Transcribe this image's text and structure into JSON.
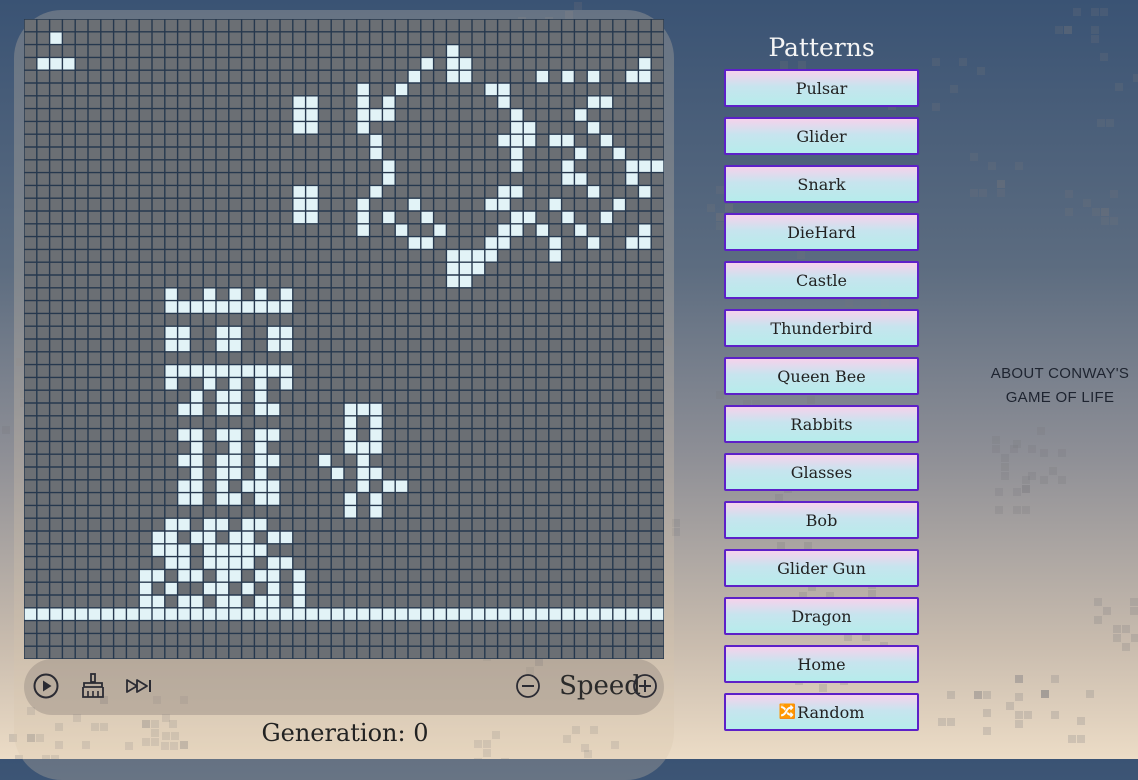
{
  "game": {
    "generation_label": "Generation:",
    "generation": "0",
    "speed_label": "Speed",
    "cols": 50,
    "rows": 50
  },
  "controls": {
    "play_icon": "play-circle-icon",
    "clear_icon": "broom-icon",
    "step_icon": "fast-forward-icon",
    "speed_down_icon": "minus-circle-icon",
    "speed_up_icon": "plus-circle-icon"
  },
  "patterns": {
    "title": "Patterns",
    "items": [
      "Pulsar",
      "Glider",
      "Snark",
      "DieHard",
      "Castle",
      "Thunderbird",
      "Queen Bee",
      "Rabbits",
      "Glasses",
      "Bob",
      "Glider Gun",
      "Dragon",
      "Home",
      "Random"
    ],
    "random_icon": "shuffle-icon"
  },
  "about": {
    "line1": "ABOUT CONWAY'S",
    "line2": "GAME OF LIFE"
  },
  "colors": {
    "grid_line": "#26384e",
    "dead_cell": "#6b6f74",
    "live_cell": "#e2f3f7",
    "button_border": "#5d20c8"
  },
  "live_cells": [
    [
      2,
      1
    ],
    [
      1,
      3
    ],
    [
      2,
      3
    ],
    [
      3,
      3
    ],
    [
      33,
      2
    ],
    [
      33,
      3
    ],
    [
      34,
      3
    ],
    [
      33,
      4
    ],
    [
      34,
      4
    ],
    [
      36,
      5
    ],
    [
      37,
      5
    ],
    [
      37,
      6
    ],
    [
      38,
      7
    ],
    [
      38,
      8
    ],
    [
      39,
      8
    ],
    [
      37,
      9
    ],
    [
      38,
      9
    ],
    [
      39,
      9
    ],
    [
      38,
      10
    ],
    [
      31,
      3
    ],
    [
      30,
      4
    ],
    [
      29,
      5
    ],
    [
      28,
      6
    ],
    [
      28,
      7
    ],
    [
      27,
      7
    ],
    [
      40,
      4
    ],
    [
      42,
      4
    ],
    [
      44,
      4
    ],
    [
      48,
      3
    ],
    [
      47,
      4
    ],
    [
      48,
      4
    ],
    [
      50,
      4
    ],
    [
      50,
      5
    ],
    [
      50,
      6
    ],
    [
      50,
      7
    ],
    [
      50,
      8
    ],
    [
      50,
      9
    ],
    [
      43,
      7
    ],
    [
      44,
      8
    ],
    [
      45,
      9
    ],
    [
      46,
      10
    ],
    [
      44,
      6
    ],
    [
      45,
      6
    ],
    [
      41,
      9
    ],
    [
      42,
      9
    ],
    [
      38,
      11
    ],
    [
      43,
      10
    ],
    [
      42,
      11
    ],
    [
      42,
      12
    ],
    [
      43,
      12
    ],
    [
      44,
      13
    ],
    [
      47,
      11
    ],
    [
      48,
      11
    ],
    [
      49,
      11
    ],
    [
      50,
      11
    ],
    [
      47,
      12
    ],
    [
      48,
      13
    ],
    [
      21,
      6
    ],
    [
      22,
      6
    ],
    [
      21,
      7
    ],
    [
      22,
      7
    ],
    [
      21,
      8
    ],
    [
      22,
      8
    ],
    [
      21,
      13
    ],
    [
      22,
      13
    ],
    [
      21,
      14
    ],
    [
      22,
      14
    ],
    [
      21,
      15
    ],
    [
      22,
      15
    ],
    [
      26,
      5
    ],
    [
      26,
      6
    ],
    [
      26,
      7
    ],
    [
      26,
      8
    ],
    [
      27,
      9
    ],
    [
      27,
      10
    ],
    [
      28,
      11
    ],
    [
      28,
      12
    ],
    [
      27,
      13
    ],
    [
      26,
      14
    ],
    [
      26,
      15
    ],
    [
      26,
      16
    ],
    [
      28,
      15
    ],
    [
      29,
      16
    ],
    [
      30,
      17
    ],
    [
      31,
      17
    ],
    [
      30,
      14
    ],
    [
      31,
      15
    ],
    [
      32,
      16
    ],
    [
      50,
      12
    ],
    [
      50,
      13
    ],
    [
      50,
      14
    ],
    [
      50,
      15
    ],
    [
      50,
      16
    ],
    [
      48,
      17
    ],
    [
      47,
      17
    ],
    [
      48,
      16
    ],
    [
      50,
      17
    ],
    [
      50,
      18
    ],
    [
      37,
      13
    ],
    [
      38,
      13
    ],
    [
      36,
      14
    ],
    [
      37,
      14
    ],
    [
      38,
      15
    ],
    [
      39,
      15
    ],
    [
      37,
      16
    ],
    [
      38,
      16
    ],
    [
      36,
      17
    ],
    [
      37,
      17
    ],
    [
      35,
      18
    ],
    [
      36,
      18
    ],
    [
      34,
      18
    ],
    [
      33,
      18
    ],
    [
      34,
      19
    ],
    [
      33,
      19
    ],
    [
      33,
      20
    ],
    [
      34,
      20
    ],
    [
      35,
      19
    ],
    [
      41,
      14
    ],
    [
      42,
      15
    ],
    [
      43,
      16
    ],
    [
      40,
      16
    ],
    [
      44,
      17
    ],
    [
      45,
      15
    ],
    [
      46,
      14
    ],
    [
      41,
      17
    ],
    [
      41,
      18
    ],
    [
      11,
      21
    ],
    [
      14,
      21
    ],
    [
      16,
      21
    ],
    [
      18,
      21
    ],
    [
      20,
      21
    ],
    [
      11,
      22
    ],
    [
      12,
      22
    ],
    [
      13,
      22
    ],
    [
      14,
      22
    ],
    [
      15,
      22
    ],
    [
      16,
      22
    ],
    [
      17,
      22
    ],
    [
      18,
      22
    ],
    [
      19,
      22
    ],
    [
      20,
      22
    ],
    [
      11,
      24
    ],
    [
      12,
      24
    ],
    [
      15,
      24
    ],
    [
      16,
      24
    ],
    [
      19,
      24
    ],
    [
      20,
      24
    ],
    [
      11,
      25
    ],
    [
      12,
      25
    ],
    [
      15,
      25
    ],
    [
      16,
      25
    ],
    [
      19,
      25
    ],
    [
      20,
      25
    ],
    [
      11,
      27
    ],
    [
      12,
      27
    ],
    [
      13,
      27
    ],
    [
      14,
      27
    ],
    [
      15,
      27
    ],
    [
      16,
      27
    ],
    [
      17,
      27
    ],
    [
      18,
      27
    ],
    [
      19,
      27
    ],
    [
      20,
      27
    ],
    [
      11,
      28
    ],
    [
      14,
      28
    ],
    [
      16,
      28
    ],
    [
      18,
      28
    ],
    [
      20,
      28
    ],
    [
      13,
      29
    ],
    [
      15,
      29
    ],
    [
      16,
      29
    ],
    [
      18,
      29
    ],
    [
      12,
      30
    ],
    [
      13,
      30
    ],
    [
      15,
      30
    ],
    [
      16,
      30
    ],
    [
      18,
      30
    ],
    [
      19,
      30
    ],
    [
      12,
      32
    ],
    [
      13,
      32
    ],
    [
      15,
      32
    ],
    [
      16,
      32
    ],
    [
      18,
      32
    ],
    [
      19,
      32
    ],
    [
      13,
      33
    ],
    [
      16,
      33
    ],
    [
      18,
      33
    ],
    [
      12,
      34
    ],
    [
      13,
      34
    ],
    [
      15,
      34
    ],
    [
      16,
      34
    ],
    [
      18,
      34
    ],
    [
      19,
      34
    ],
    [
      13,
      35
    ],
    [
      15,
      35
    ],
    [
      16,
      35
    ],
    [
      18,
      35
    ],
    [
      12,
      36
    ],
    [
      13,
      36
    ],
    [
      15,
      36
    ],
    [
      17,
      36
    ],
    [
      18,
      36
    ],
    [
      19,
      36
    ],
    [
      12,
      37
    ],
    [
      13,
      37
    ],
    [
      15,
      37
    ],
    [
      16,
      37
    ],
    [
      18,
      37
    ],
    [
      19,
      37
    ],
    [
      11,
      39
    ],
    [
      12,
      39
    ],
    [
      14,
      39
    ],
    [
      15,
      39
    ],
    [
      17,
      39
    ],
    [
      18,
      39
    ],
    [
      10,
      40
    ],
    [
      11,
      40
    ],
    [
      13,
      40
    ],
    [
      14,
      40
    ],
    [
      16,
      40
    ],
    [
      17,
      40
    ],
    [
      19,
      40
    ],
    [
      20,
      40
    ],
    [
      10,
      41
    ],
    [
      11,
      41
    ],
    [
      12,
      41
    ],
    [
      14,
      41
    ],
    [
      15,
      41
    ],
    [
      16,
      41
    ],
    [
      17,
      41
    ],
    [
      18,
      41
    ],
    [
      11,
      42
    ],
    [
      12,
      42
    ],
    [
      14,
      42
    ],
    [
      15,
      42
    ],
    [
      16,
      42
    ],
    [
      17,
      42
    ],
    [
      19,
      42
    ],
    [
      20,
      42
    ],
    [
      9,
      43
    ],
    [
      10,
      43
    ],
    [
      12,
      43
    ],
    [
      13,
      43
    ],
    [
      15,
      43
    ],
    [
      16,
      43
    ],
    [
      18,
      43
    ],
    [
      19,
      43
    ],
    [
      21,
      43
    ],
    [
      9,
      44
    ],
    [
      11,
      44
    ],
    [
      14,
      44
    ],
    [
      15,
      44
    ],
    [
      17,
      44
    ],
    [
      19,
      44
    ],
    [
      21,
      44
    ],
    [
      9,
      45
    ],
    [
      10,
      45
    ],
    [
      12,
      45
    ],
    [
      13,
      45
    ],
    [
      15,
      45
    ],
    [
      16,
      45
    ],
    [
      18,
      45
    ],
    [
      19,
      45
    ],
    [
      21,
      45
    ],
    [
      25,
      30
    ],
    [
      26,
      30
    ],
    [
      27,
      30
    ],
    [
      25,
      31
    ],
    [
      27,
      31
    ],
    [
      25,
      32
    ],
    [
      27,
      32
    ],
    [
      25,
      33
    ],
    [
      26,
      33
    ],
    [
      27,
      33
    ],
    [
      23,
      34
    ],
    [
      26,
      34
    ],
    [
      24,
      35
    ],
    [
      26,
      35
    ],
    [
      27,
      35
    ],
    [
      28,
      36
    ],
    [
      29,
      36
    ],
    [
      26,
      36
    ],
    [
      25,
      37
    ],
    [
      27,
      37
    ],
    [
      25,
      38
    ],
    [
      27,
      38
    ],
    [
      0,
      46
    ],
    [
      1,
      46
    ],
    [
      2,
      46
    ],
    [
      3,
      46
    ],
    [
      4,
      46
    ],
    [
      5,
      46
    ],
    [
      6,
      46
    ],
    [
      7,
      46
    ],
    [
      8,
      46
    ],
    [
      9,
      46
    ],
    [
      10,
      46
    ],
    [
      11,
      46
    ],
    [
      12,
      46
    ],
    [
      13,
      46
    ],
    [
      14,
      46
    ],
    [
      15,
      46
    ],
    [
      16,
      46
    ],
    [
      17,
      46
    ],
    [
      18,
      46
    ],
    [
      19,
      46
    ],
    [
      20,
      46
    ],
    [
      21,
      46
    ],
    [
      22,
      46
    ],
    [
      23,
      46
    ],
    [
      24,
      46
    ],
    [
      25,
      46
    ],
    [
      26,
      46
    ],
    [
      27,
      46
    ],
    [
      28,
      46
    ],
    [
      29,
      46
    ],
    [
      30,
      46
    ],
    [
      31,
      46
    ],
    [
      32,
      46
    ],
    [
      33,
      46
    ],
    [
      34,
      46
    ],
    [
      35,
      46
    ],
    [
      36,
      46
    ],
    [
      37,
      46
    ],
    [
      38,
      46
    ],
    [
      39,
      46
    ],
    [
      40,
      46
    ],
    [
      41,
      46
    ],
    [
      42,
      46
    ],
    [
      43,
      46
    ],
    [
      44,
      46
    ],
    [
      45,
      46
    ],
    [
      46,
      46
    ],
    [
      47,
      46
    ],
    [
      48,
      46
    ],
    [
      49,
      46
    ]
  ]
}
